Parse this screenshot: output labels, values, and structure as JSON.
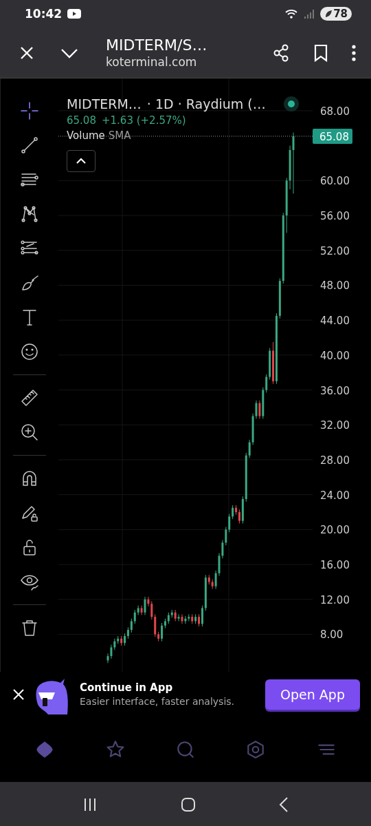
{
  "status_bar": {
    "time": "10:42",
    "battery": "78"
  },
  "browser": {
    "title": "MIDTERM/S…",
    "url": "koterminal.com"
  },
  "tool_groups": [
    [
      {
        "selected": true
      },
      {
        "selected": false
      },
      {
        "selected": false
      },
      {
        "selected": false
      },
      {
        "selected": false
      },
      {
        "selected": false
      },
      {
        "selected": false
      },
      {
        "selected": false
      }
    ],
    [
      {
        "selected": false
      },
      {
        "selected": false
      }
    ],
    [
      {
        "selected": false
      },
      {
        "selected": false
      },
      {
        "selected": false
      },
      {
        "selected": false
      }
    ],
    [
      {
        "selected": false
      }
    ]
  ],
  "legend": {
    "symbol": "MIDTERM…",
    "details": "· 1D · Raydium (…",
    "price": "65.08",
    "change": "+1.63 (+2.57%)",
    "indicator": "Volume",
    "indicator_param": "SMA"
  },
  "chart_data": {
    "type": "candlestick",
    "grid": true,
    "ylim": [
      3.7,
      71.7
    ],
    "yticks": [
      {
        "value": 8,
        "label": "8.00"
      },
      {
        "value": 12,
        "label": "12.00"
      },
      {
        "value": 16,
        "label": "16.00"
      },
      {
        "value": 20,
        "label": "20.00"
      },
      {
        "value": 24,
        "label": "24.00"
      },
      {
        "value": 28,
        "label": "28.00"
      },
      {
        "value": 32,
        "label": "32.00"
      },
      {
        "value": 36,
        "label": "36.00"
      },
      {
        "value": 40,
        "label": "40.00"
      },
      {
        "value": 44,
        "label": "44.00"
      },
      {
        "value": 48,
        "label": "48.00"
      },
      {
        "value": 52,
        "label": "52.00"
      },
      {
        "value": 56,
        "label": "56.00"
      },
      {
        "value": 60,
        "label": "60.00"
      },
      {
        "value": 68,
        "label": "68.00"
      }
    ],
    "ref_lines": [
      {
        "axis": "y",
        "value": 65.08,
        "label": "65.08"
      }
    ],
    "ohlc": [
      [
        5.0,
        5.8,
        4.7,
        5.5
      ],
      [
        5.5,
        6.8,
        5.2,
        6.5
      ],
      [
        6.5,
        7.5,
        6.2,
        7.2
      ],
      [
        7.2,
        7.8,
        6.9,
        7.5
      ],
      [
        7.5,
        7.8,
        6.7,
        7.0
      ],
      [
        7.0,
        8.1,
        6.7,
        7.8
      ],
      [
        7.8,
        8.8,
        7.5,
        8.5
      ],
      [
        8.5,
        9.8,
        8.2,
        9.5
      ],
      [
        9.5,
        10.8,
        9.2,
        10.5
      ],
      [
        10.5,
        11.3,
        10.2,
        11.0
      ],
      [
        11.0,
        11.3,
        10.2,
        10.5
      ],
      [
        10.5,
        12.3,
        10.2,
        12.0
      ],
      [
        12.0,
        12.3,
        11.2,
        11.5
      ],
      [
        11.5,
        11.8,
        9.7,
        10.0
      ],
      [
        10.0,
        10.3,
        7.7,
        8.0
      ],
      [
        8.0,
        8.3,
        7.2,
        7.5
      ],
      [
        7.5,
        9.3,
        7.2,
        9.0
      ],
      [
        9.0,
        9.8,
        8.7,
        9.5
      ],
      [
        9.5,
        10.5,
        9.2,
        10.2
      ],
      [
        10.2,
        10.8,
        9.9,
        10.5
      ],
      [
        10.5,
        10.8,
        9.5,
        9.8
      ],
      [
        9.8,
        10.3,
        9.5,
        10.0
      ],
      [
        10.0,
        10.3,
        9.2,
        9.5
      ],
      [
        9.5,
        10.1,
        9.2,
        9.8
      ],
      [
        9.8,
        10.3,
        9.5,
        10.0
      ],
      [
        10.0,
        10.3,
        9.2,
        9.5
      ],
      [
        9.5,
        10.3,
        9.2,
        10.0
      ],
      [
        10.0,
        10.3,
        8.9,
        9.2
      ],
      [
        9.2,
        11.3,
        8.9,
        11.0
      ],
      [
        11.0,
        14.8,
        10.7,
        14.5
      ],
      [
        14.5,
        14.8,
        13.7,
        14.0
      ],
      [
        14.0,
        14.3,
        13.2,
        13.5
      ],
      [
        13.5,
        15.3,
        13.2,
        15.0
      ],
      [
        15.0,
        17.3,
        14.7,
        17.0
      ],
      [
        17.0,
        18.8,
        16.7,
        18.5
      ],
      [
        18.5,
        20.3,
        18.2,
        20.0
      ],
      [
        20.0,
        21.8,
        19.7,
        21.5
      ],
      [
        21.5,
        22.8,
        21.2,
        22.5
      ],
      [
        22.5,
        22.8,
        21.7,
        22.0
      ],
      [
        22.0,
        22.3,
        20.7,
        21.0
      ],
      [
        21.0,
        23.8,
        20.7,
        23.5
      ],
      [
        23.5,
        28.8,
        23.2,
        28.5
      ],
      [
        28.5,
        30.3,
        28.2,
        30.0
      ],
      [
        30.0,
        33.3,
        29.7,
        33.0
      ],
      [
        33.0,
        34.8,
        32.7,
        34.5
      ],
      [
        34.5,
        34.8,
        32.7,
        33.0
      ],
      [
        33.0,
        36.3,
        32.7,
        36.0
      ],
      [
        36.0,
        37.8,
        35.7,
        37.5
      ],
      [
        37.5,
        40.8,
        37.2,
        40.5
      ],
      [
        40.5,
        41.5,
        36.7,
        37.0
      ],
      [
        37.0,
        44.8,
        36.7,
        44.5
      ],
      [
        44.5,
        48.8,
        44.2,
        48.5
      ],
      [
        48.5,
        56.3,
        48.2,
        56.0
      ],
      [
        56.0,
        60.3,
        54.0,
        60.0
      ],
      [
        60.0,
        64.0,
        59.0,
        63.5
      ],
      [
        63.5,
        65.5,
        58.5,
        65.08
      ]
    ]
  },
  "banner": {
    "title": "Continue in App",
    "subtitle": "Easier interface, faster analysis.",
    "button": "Open App"
  },
  "bottom_nav": [
    {
      "selected": true
    },
    {
      "selected": false
    },
    {
      "selected": false
    },
    {
      "selected": false
    },
    {
      "selected": false
    }
  ]
}
